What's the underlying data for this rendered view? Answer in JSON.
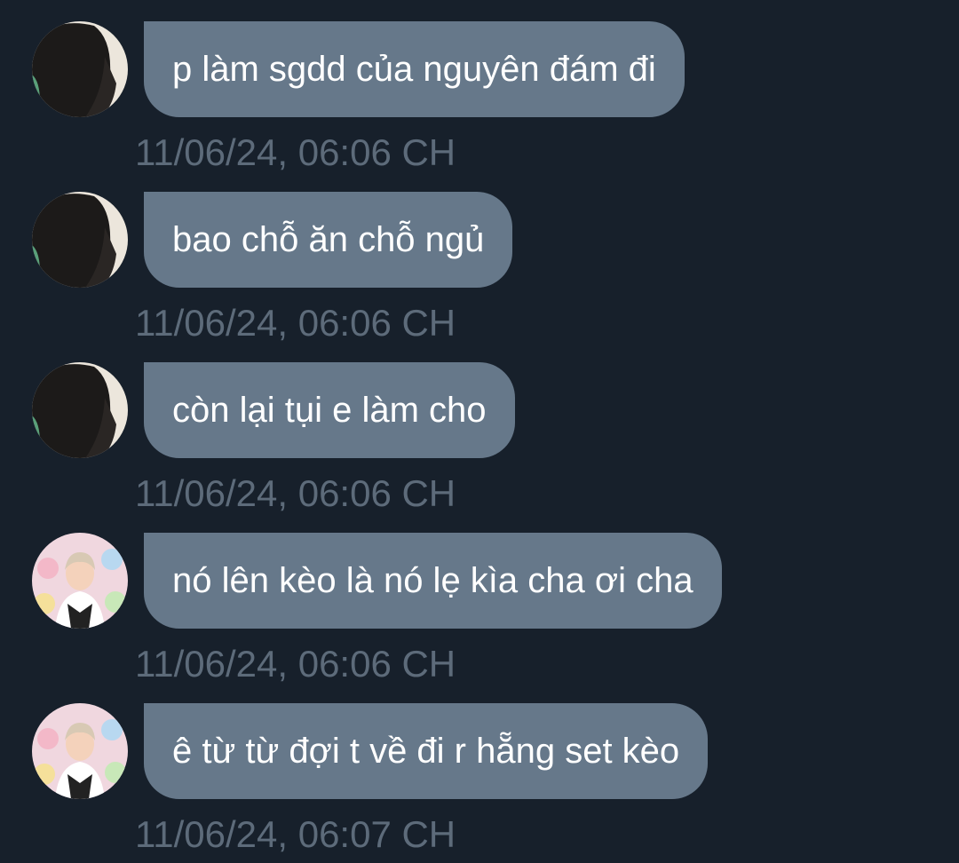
{
  "messages": [
    {
      "avatar": "dark-avatar",
      "text": "p làm sgdd của nguyên đám đi",
      "time": "11/06/24, 06:06 CH"
    },
    {
      "avatar": "dark-avatar",
      "text": "bao chỗ ăn chỗ ngủ",
      "time": "11/06/24, 06:06 CH"
    },
    {
      "avatar": "dark-avatar",
      "text": "còn lại tụi e làm cho",
      "time": "11/06/24, 06:06 CH"
    },
    {
      "avatar": "colorful-avatar",
      "text": "nó lên kèo là nó lẹ kìa cha ơi cha",
      "time": "11/06/24, 06:06 CH"
    },
    {
      "avatar": "colorful-avatar",
      "text": "ê từ từ đợi t về đi r hẵng set kèo",
      "time": "11/06/24, 06:07 CH"
    }
  ],
  "colors": {
    "background": "#17202b",
    "bubble": "#66788a",
    "bubble_text": "#ffffff",
    "timestamp": "#5d6b7a"
  }
}
